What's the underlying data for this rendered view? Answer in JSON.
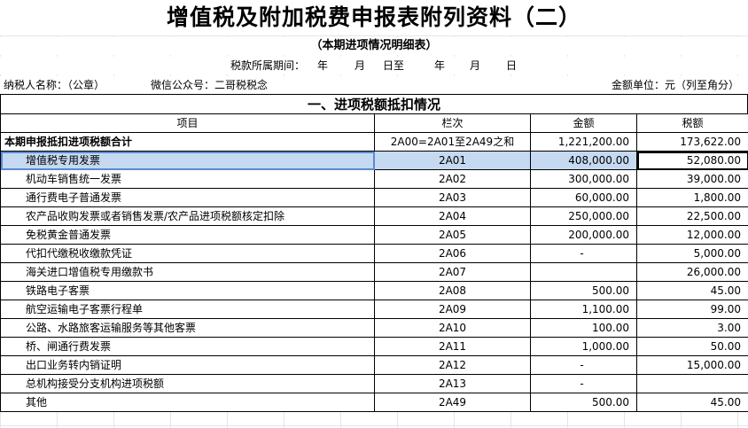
{
  "title": "增值税及附加税费申报表附列资料（二）",
  "subtitle": "（本期进项情况明细表）",
  "period": {
    "label": "税款所属期间：",
    "year1": "年",
    "month1": "月",
    "day_to": "日至",
    "year2": "年",
    "month2": "月",
    "day2": "日"
  },
  "taxpayer": {
    "name_label": "纳税人名称：（公章）",
    "wechat": "微信公众号：二哥税税念",
    "unit": "金额单位：元（列至角分）"
  },
  "section_title": "一、进项税额抵扣情况",
  "headers": {
    "item": "项目",
    "column": "栏次",
    "amount": "金额",
    "tax": "税额"
  },
  "rows": [
    {
      "item": "本期申报抵扣进项税额合计",
      "column": "2A00=2A01至2A49之和",
      "amount": "1,221,200.00",
      "tax": "173,622.00"
    },
    {
      "item": "增值税专用发票",
      "column": "2A01",
      "amount": "408,000.00",
      "tax": "52,080.00"
    },
    {
      "item": "机动车销售统一发票",
      "column": "2A02",
      "amount": "300,000.00",
      "tax": "39,000.00"
    },
    {
      "item": "通行费电子普通发票",
      "column": "2A03",
      "amount": "60,000.00",
      "tax": "1,800.00"
    },
    {
      "item": "农产品收购发票或者销售发票/农产品进项税额核定扣除",
      "column": "2A04",
      "amount": "250,000.00",
      "tax": "22,500.00"
    },
    {
      "item": "免税黄金普通发票",
      "column": "2A05",
      "amount": "200,000.00",
      "tax": "12,000.00"
    },
    {
      "item": "代扣代缴税收缴款凭证",
      "column": "2A06",
      "amount": "-",
      "tax": "5,000.00"
    },
    {
      "item": "海关进口增值税专用缴款书",
      "column": "2A07",
      "amount": "",
      "tax": "26,000.00"
    },
    {
      "item": "铁路电子客票",
      "column": "2A08",
      "amount": "500.00",
      "tax": "45.00"
    },
    {
      "item": "航空运输电子客票行程单",
      "column": "2A09",
      "amount": "1,100.00",
      "tax": "99.00"
    },
    {
      "item": "公路、水路旅客运输服务等其他客票",
      "column": "2A10",
      "amount": "100.00",
      "tax": "3.00"
    },
    {
      "item": "桥、闸通行费发票",
      "column": "2A11",
      "amount": "1,000.00",
      "tax": "50.00"
    },
    {
      "item": "出口业务转内销证明",
      "column": "2A12",
      "amount": "-",
      "tax": "15,000.00"
    },
    {
      "item": "总机构接受分支机构进项税额",
      "column": "2A13",
      "amount": "-",
      "tax": ""
    },
    {
      "item": "其他",
      "column": "2A49",
      "amount": "500.00",
      "tax": "45.00"
    }
  ],
  "colors": {
    "selection": "#c5d9f1",
    "grid": "#d4d4d4"
  }
}
